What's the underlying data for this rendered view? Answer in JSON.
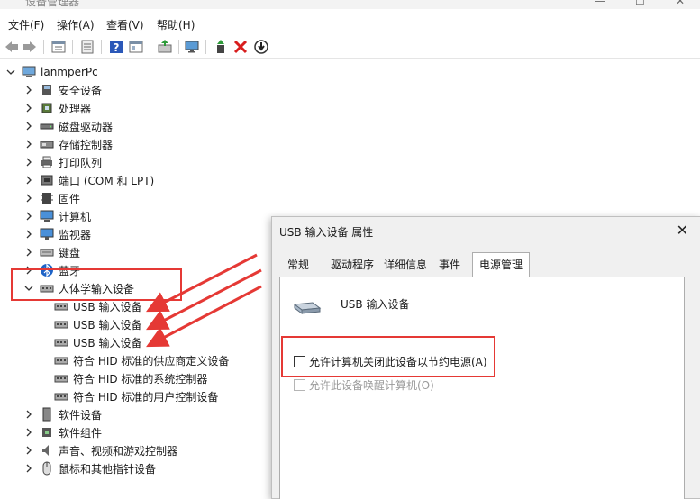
{
  "window": {
    "title": "设备管理器",
    "controls": [
      "—",
      "☐",
      "✕"
    ]
  },
  "menu": [
    "文件(F)",
    "操作(A)",
    "查看(V)",
    "帮助(H)"
  ],
  "toolbar": [
    "back-icon",
    "forward-icon",
    "properties-icon",
    "show-hidden-icon",
    "help-icon",
    "view-icon",
    "update-driver-icon",
    "monitor-icon",
    "enable-device-icon",
    "uninstall-icon",
    "scan-icon"
  ],
  "tree": {
    "root": "lanmperPc",
    "items": [
      {
        "label": "安全设备",
        "icon": "security-device-icon"
      },
      {
        "label": "处理器",
        "icon": "processor-icon"
      },
      {
        "label": "磁盘驱动器",
        "icon": "disk-drive-icon"
      },
      {
        "label": "存储控制器",
        "icon": "storage-controller-icon"
      },
      {
        "label": "打印队列",
        "icon": "printer-icon"
      },
      {
        "label": "端口 (COM 和 LPT)",
        "icon": "port-icon"
      },
      {
        "label": "固件",
        "icon": "firmware-icon"
      },
      {
        "label": "计算机",
        "icon": "computer-icon"
      },
      {
        "label": "监视器",
        "icon": "monitor-icon"
      },
      {
        "label": "键盘",
        "icon": "keyboard-icon"
      },
      {
        "label": "蓝牙",
        "icon": "bluetooth-icon"
      },
      {
        "label": "人体学输入设备",
        "icon": "hid-icon",
        "expanded": true,
        "children": [
          {
            "label": "USB 输入设备"
          },
          {
            "label": "USB 输入设备"
          },
          {
            "label": "USB 输入设备"
          },
          {
            "label": "符合 HID 标准的供应商定义设备"
          },
          {
            "label": "符合 HID 标准的系统控制器"
          },
          {
            "label": "符合 HID 标准的用户控制设备"
          }
        ]
      },
      {
        "label": "软件设备",
        "icon": "software-device-icon"
      },
      {
        "label": "软件组件",
        "icon": "software-component-icon"
      },
      {
        "label": "声音、视频和游戏控制器",
        "icon": "sound-icon"
      },
      {
        "label": "鼠标和其他指针设备",
        "icon": "mouse-icon"
      }
    ]
  },
  "dialog": {
    "title": "USB 输入设备 属性",
    "tabs": [
      "常规",
      "驱动程序",
      "详细信息",
      "事件",
      "电源管理"
    ],
    "active_tab": "电源管理",
    "device_name": "USB 输入设备",
    "options": [
      {
        "label": "允许计算机关闭此设备以节约电源(A)",
        "checked": false,
        "enabled": true
      },
      {
        "label": "允许此设备唤醒计算机(O)",
        "checked": false,
        "enabled": false
      }
    ]
  },
  "colors": {
    "highlight": "#e53935"
  }
}
